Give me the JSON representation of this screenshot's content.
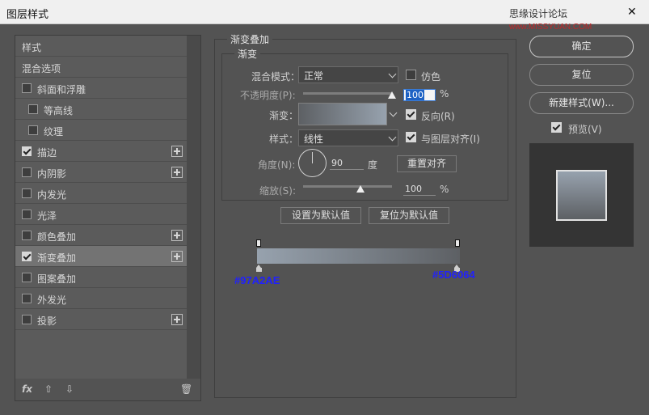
{
  "window": {
    "title": "图层样式",
    "watermark": "思缘设计论坛",
    "watermark_url": "www.MISSYUAN.COM",
    "close_glyph": "✕"
  },
  "style_list": {
    "items": [
      {
        "label": "样式",
        "checkbox": false,
        "checked": false,
        "plus": false,
        "indent": 0,
        "selected": false
      },
      {
        "label": "混合选项",
        "checkbox": false,
        "checked": false,
        "plus": false,
        "indent": 0,
        "selected": false
      },
      {
        "label": "斜面和浮雕",
        "checkbox": true,
        "checked": false,
        "plus": false,
        "indent": 0,
        "selected": false
      },
      {
        "label": "等高线",
        "checkbox": true,
        "checked": false,
        "plus": false,
        "indent": 1,
        "selected": false
      },
      {
        "label": "纹理",
        "checkbox": true,
        "checked": false,
        "plus": false,
        "indent": 1,
        "selected": false
      },
      {
        "label": "描边",
        "checkbox": true,
        "checked": true,
        "plus": true,
        "indent": 0,
        "selected": false
      },
      {
        "label": "内阴影",
        "checkbox": true,
        "checked": false,
        "plus": true,
        "indent": 0,
        "selected": false
      },
      {
        "label": "内发光",
        "checkbox": true,
        "checked": false,
        "plus": false,
        "indent": 0,
        "selected": false
      },
      {
        "label": "光泽",
        "checkbox": true,
        "checked": false,
        "plus": false,
        "indent": 0,
        "selected": false
      },
      {
        "label": "颜色叠加",
        "checkbox": true,
        "checked": false,
        "plus": true,
        "indent": 0,
        "selected": false
      },
      {
        "label": "渐变叠加",
        "checkbox": true,
        "checked": true,
        "plus": true,
        "indent": 0,
        "selected": true
      },
      {
        "label": "图案叠加",
        "checkbox": true,
        "checked": false,
        "plus": false,
        "indent": 0,
        "selected": false
      },
      {
        "label": "外发光",
        "checkbox": true,
        "checked": false,
        "plus": false,
        "indent": 0,
        "selected": false
      },
      {
        "label": "投影",
        "checkbox": true,
        "checked": false,
        "plus": true,
        "indent": 0,
        "selected": false
      }
    ],
    "bottom": {
      "fx": "fx",
      "up": "⇧",
      "down": "⇩",
      "trash": "🗑"
    }
  },
  "gradient_overlay": {
    "section_title": "渐变叠加",
    "sub_title": "渐变",
    "blend_mode_label": "混合模式：",
    "blend_mode_value": "正常",
    "dither_label": "仿色",
    "dither_checked": false,
    "opacity_label": "不透明度(P):",
    "opacity_value": "100",
    "opacity_percent": 100,
    "percent_unit": "%",
    "gradient_label": "渐变：",
    "reverse_label": "反向(R)",
    "reverse_checked": true,
    "style_label": "样式：",
    "style_value": "线性",
    "align_label": "与图层对齐(I)",
    "align_checked": true,
    "angle_label": "角度(N):",
    "angle_value": "90",
    "angle_unit": "度",
    "reset_align_button": "重置对齐",
    "scale_label": "缩放(S):",
    "scale_value": "100",
    "scale_percent": 100,
    "set_default_button": "设置为默认值",
    "reset_default_button": "复位为默认值"
  },
  "gradient_editor": {
    "start_color": "#97A2AE",
    "end_color": "#5D6064",
    "start_label": "#97A2AE",
    "end_label": "#5D6064"
  },
  "actions": {
    "ok": "确定",
    "reset": "复位",
    "new_style": "新建样式(W)...",
    "preview_label": "预览(V)",
    "preview_checked": true
  },
  "colors": {
    "panel_bg": "#535353",
    "list_bg": "#5b5b5b",
    "selected_row": "#737373",
    "annotation_blue": "#2020ff"
  }
}
